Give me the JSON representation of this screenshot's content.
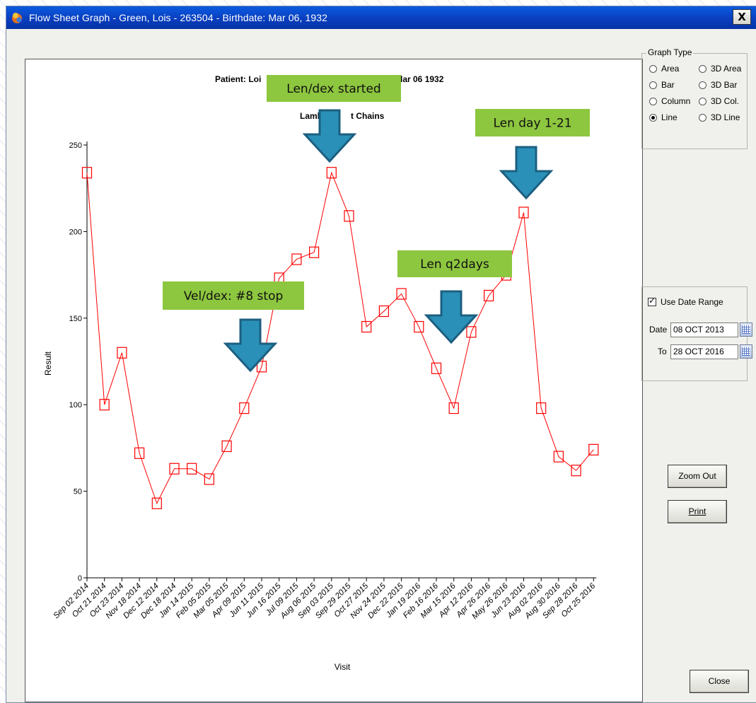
{
  "window": {
    "title": "Flow Sheet Graph  - Green, Lois  - 263504 - Birthdate: Mar 06, 1932",
    "close_label": "X"
  },
  "graph_type": {
    "legend": "Graph Type",
    "options": [
      "Area",
      "3D Area",
      "Bar",
      "3D Bar",
      "Column",
      "3D Col.",
      "Line",
      "3D Line"
    ],
    "selected": "Line"
  },
  "date_range": {
    "use_label": "Use Date Range",
    "checked": true,
    "date_label": "Date",
    "date_value": "08 OCT 2013",
    "to_label": "To",
    "to_value": "28 OCT 2016"
  },
  "buttons": {
    "zoom_out": "Zoom Out",
    "print": "Print",
    "close": "Close"
  },
  "annotations": [
    {
      "text": "Len/dex started"
    },
    {
      "text": "Len day 1-21"
    },
    {
      "text": "Len q2days"
    },
    {
      "text": "Vel/dex: #8 stop"
    }
  ],
  "chart_data": {
    "type": "line",
    "title_left": "Patient: Loi",
    "title_right": "lar 06 1932",
    "subtitle_left": "Lambda",
    "subtitle_right": "t Chains",
    "xlabel": "Visit",
    "ylabel": "Result",
    "ylim": [
      0,
      250
    ],
    "yticks": [
      0,
      50,
      100,
      150,
      200,
      250
    ],
    "grid": false,
    "series_color": "#ff0000",
    "categories": [
      "Sep 02 2014",
      "Oct 21 2014",
      "Oct 23 2014",
      "Nov 18 2014",
      "Dec 12 2014",
      "Dec 18 2014",
      "Jan 14 2015",
      "Feb 05 2015",
      "Mar 05 2015",
      "Apr 09 2015",
      "Jun 11 2015",
      "Jun 16 2015",
      "Jul 09 2015",
      "Aug 06 2015",
      "Sep 03 2015",
      "Sep 29 2015",
      "Oct 27 2015",
      "Nov 24 2015",
      "Dec 22 2015",
      "Jan 19 2016",
      "Feb 16 2016",
      "Mar 15 2016",
      "Apr 12 2016",
      "Apr 26 2016",
      "May 26 2016",
      "Jun 23 2016",
      "Aug 02 2016",
      "Aug 30 2016",
      "Sep 28 2016",
      "Oct 25 2016"
    ],
    "values": [
      234,
      100,
      130,
      72,
      43,
      63,
      63,
      57,
      76,
      98,
      122,
      173,
      184,
      188,
      234,
      209,
      145,
      154,
      164,
      145,
      121,
      98,
      142,
      163,
      175,
      211,
      98,
      70,
      62,
      74
    ]
  }
}
